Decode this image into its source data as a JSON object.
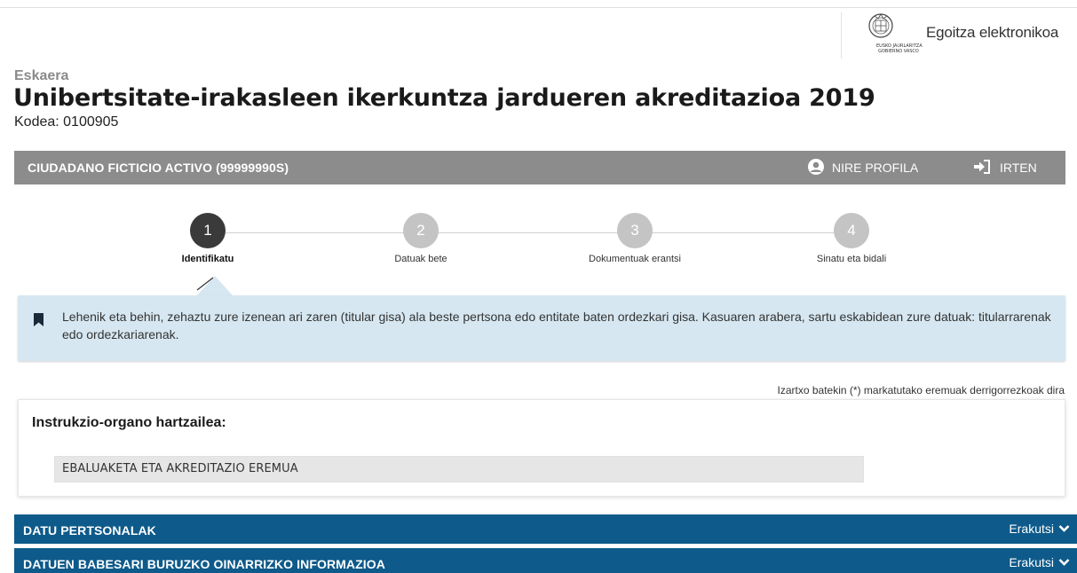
{
  "header": {
    "logo_text": "EUSKO JAURLARITZA\nGOBIERNO VASCO",
    "site_title": "Egoitza elektronikoa"
  },
  "request": {
    "type_label": "Eskaera",
    "title": "Unibertsitate-irakasleen ikerkuntza jardueren akreditazioa 2019",
    "code": "Kodea: 0100905"
  },
  "userbar": {
    "user_name": "CIUDADANO FICTICIO ACTIVO (99999990S)",
    "profile_label": "NIRE PROFILA",
    "logout_label": "IRTEN"
  },
  "steps": [
    {
      "number": "1",
      "label": "Identifikatu",
      "active": true
    },
    {
      "number": "2",
      "label": "Datuak bete",
      "active": false
    },
    {
      "number": "3",
      "label": "Dokumentuak erantsi",
      "active": false
    },
    {
      "number": "4",
      "label": "Sinatu eta bidali",
      "active": false
    }
  ],
  "info": {
    "text": "Lehenik eta behin, zehaztu zure izenean ari zaren (titular gisa) ala beste pertsona edo entitate baten ordezkari gisa. Kasuaren arabera, sartu eskabidean zure datuak: titularrarenak edo ordezkariarenak."
  },
  "required_note": "Izartxo batekin (*) markatutako eremuak derrigorrezkoak dira",
  "instruction_organ": {
    "label": "Instrukzio-organo hartzailea:",
    "value": "EBALUAKETA ETA AKREDITAZIO EREMUA"
  },
  "sections": [
    {
      "title": "DATU PERTSONALAK",
      "toggle_label": "Erakutsi"
    },
    {
      "title": "DATUEN BABESARI BURUZKO OINARRIZKO INFORMAZIOA",
      "toggle_label": "Erakutsi"
    }
  ],
  "colors": {
    "section_bg": "#0e5a8a",
    "userbar_bg": "#8c8c8c",
    "info_bg": "#d6e7f1",
    "step_active": "#3a3a3a",
    "step_inactive": "#c4c4c4"
  },
  "icons": {
    "profile": "user-circle-icon",
    "logout": "sign-in-arrow-icon",
    "bookmark": "bookmark-icon",
    "toggle": "chevron-down-icon"
  }
}
